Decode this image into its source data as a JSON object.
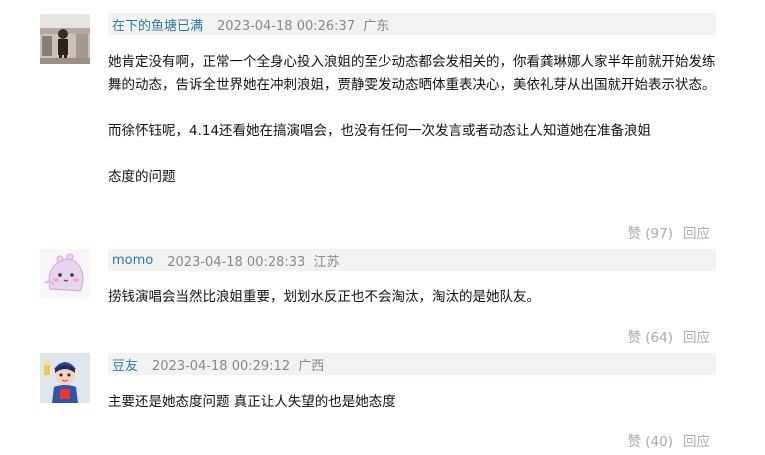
{
  "comments": [
    {
      "author": "在下的鱼塘已满",
      "time": "2023-04-18 00:26:37",
      "location": "广东",
      "text": "她肯定没有啊，正常一个全身心投入浪姐的至少动态都会发相关的，你看龚琳娜人家半年前就开始发练舞的动态，告诉全世界她在冲刺浪姐，贾静雯发动态晒体重表决心，美依礼芽从出国就开始表示状态。\n\n而徐怀钰呢，4.14还看她在搞演唱会，也没有任何一次发言或者动态让人知道她在准备浪姐\n\n态度的问题",
      "vote_label": "赞 (97)",
      "reply_label": "回应",
      "avatar_icon": "user-photo-avatar"
    },
    {
      "author": "momo",
      "time": "2023-04-18 00:28:33",
      "location": "江苏",
      "text": "捞钱演唱会当然比浪姐重要，划划水反正也不会淘汰，淘汰的是她队友。",
      "vote_label": "赞 (64)",
      "reply_label": "回应",
      "avatar_icon": "cartoon-creature-avatar"
    },
    {
      "author": "豆友",
      "time": "2023-04-18 00:29:12",
      "location": "广西",
      "text": "主要还是她态度问题 真正让人失望的也是她态度",
      "vote_label": "赞 (40)",
      "reply_label": "回应",
      "avatar_icon": "cartoon-character-avatar"
    }
  ]
}
